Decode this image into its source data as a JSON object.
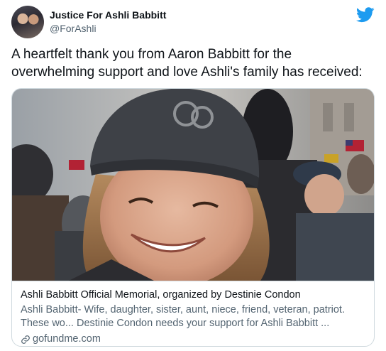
{
  "tweet": {
    "author": {
      "display_name": "Justice For Ashli Babbitt",
      "handle": "@ForAshli"
    },
    "brand_icon": "twitter-bird-icon",
    "text": "A heartfelt thank you from Aaron Babbitt for the overwhelming support and love Ashli's family has received:",
    "card": {
      "image_icon": "memorial-photo",
      "title": "Ashli Babbitt Official Memorial, organized by Destinie Condon",
      "description": "Ashli Babbitt- Wife, daughter, sister, aunt, niece, friend, veteran, patriot. These wo... Destinie Condon needs your support for Ashli Babbitt ...",
      "domain_icon": "link-icon",
      "domain": "gofundme.com"
    }
  },
  "colors": {
    "text_primary": "#0f1419",
    "text_secondary": "#536471",
    "twitter_blue": "#1d9bf0",
    "border": "#cfd9de"
  }
}
